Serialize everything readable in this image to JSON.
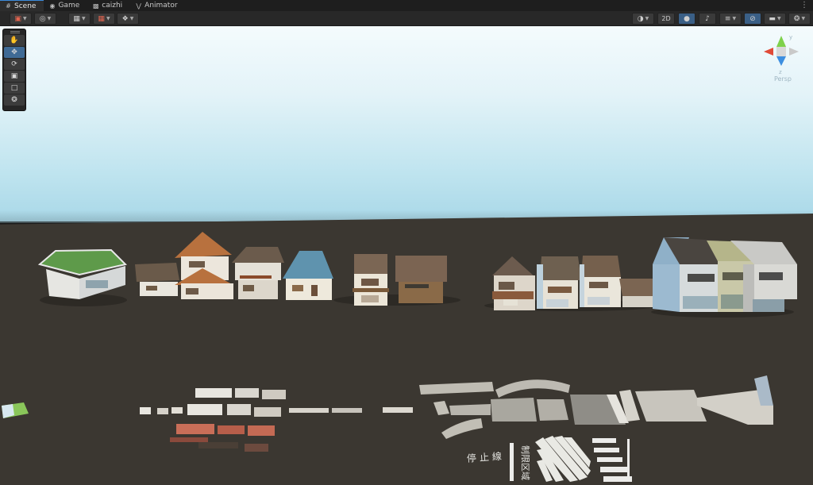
{
  "tabs": [
    {
      "label": "Scene",
      "icon": "hash-icon",
      "active": true
    },
    {
      "label": "Game",
      "icon": "gamepad-icon",
      "active": false
    },
    {
      "label": "caizhi",
      "icon": "document-icon",
      "active": false
    },
    {
      "label": "Animator",
      "icon": "animator-icon",
      "active": false
    }
  ],
  "toolbar": {
    "twod_label": "2D"
  },
  "gizmo": {
    "projection_label": "Persp",
    "axis_y": "y",
    "axis_z": "z"
  },
  "ground_text": {
    "road_markings_left": "停止線",
    "road_markings_right": "制限区域"
  },
  "colors": {
    "accent": "#3a5f86",
    "sky_top": "#f4fbfd",
    "sky_bottom": "#a9d8e8",
    "ground": "#3b3731"
  }
}
